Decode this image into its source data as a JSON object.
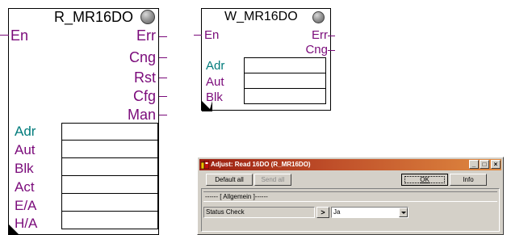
{
  "blocks": {
    "read": {
      "title": "R_MR16DO",
      "inputs": [
        "En"
      ],
      "outputs": [
        "Err",
        "Cng",
        "Rst",
        "Cfg",
        "Man"
      ],
      "params": [
        {
          "label": "Adr",
          "color": "#007b7b"
        },
        {
          "label": "Aut",
          "color": "#7a0a7a"
        },
        {
          "label": "Blk",
          "color": "#7a0a7a"
        },
        {
          "label": "Act",
          "color": "#7a0a7a"
        },
        {
          "label": "E/A",
          "color": "#7a0a7a"
        },
        {
          "label": "H/A",
          "color": "#7a0a7a"
        }
      ]
    },
    "write": {
      "title": "W_MR16DO",
      "inputs": [
        "En"
      ],
      "outputs": [
        "Err",
        "Cng"
      ],
      "params": [
        {
          "label": "Adr",
          "color": "#007b7b"
        },
        {
          "label": "Aut",
          "color": "#7a0a7a"
        },
        {
          "label": "Blk",
          "color": "#7a0a7a"
        }
      ]
    }
  },
  "dialog": {
    "title": "Adjust: Read 16DO (R_MR16DO)",
    "window_buttons": {
      "minimize": "_",
      "maximize": "□",
      "close": "×"
    },
    "toolbar": {
      "default_all": "Default all",
      "send_all": "Send all",
      "ok": "OK",
      "info": "Info"
    },
    "section": "------ [ Allgemein ]------",
    "param": {
      "label": "Status Check",
      "arrow": ">",
      "value": "Ja"
    }
  },
  "colors": {
    "pin": "#7a0a7a",
    "teal": "#007b7b",
    "titlebar_start": "#9a1e10",
    "titlebar_end": "#e08a40",
    "face": "#d4d0c8"
  }
}
